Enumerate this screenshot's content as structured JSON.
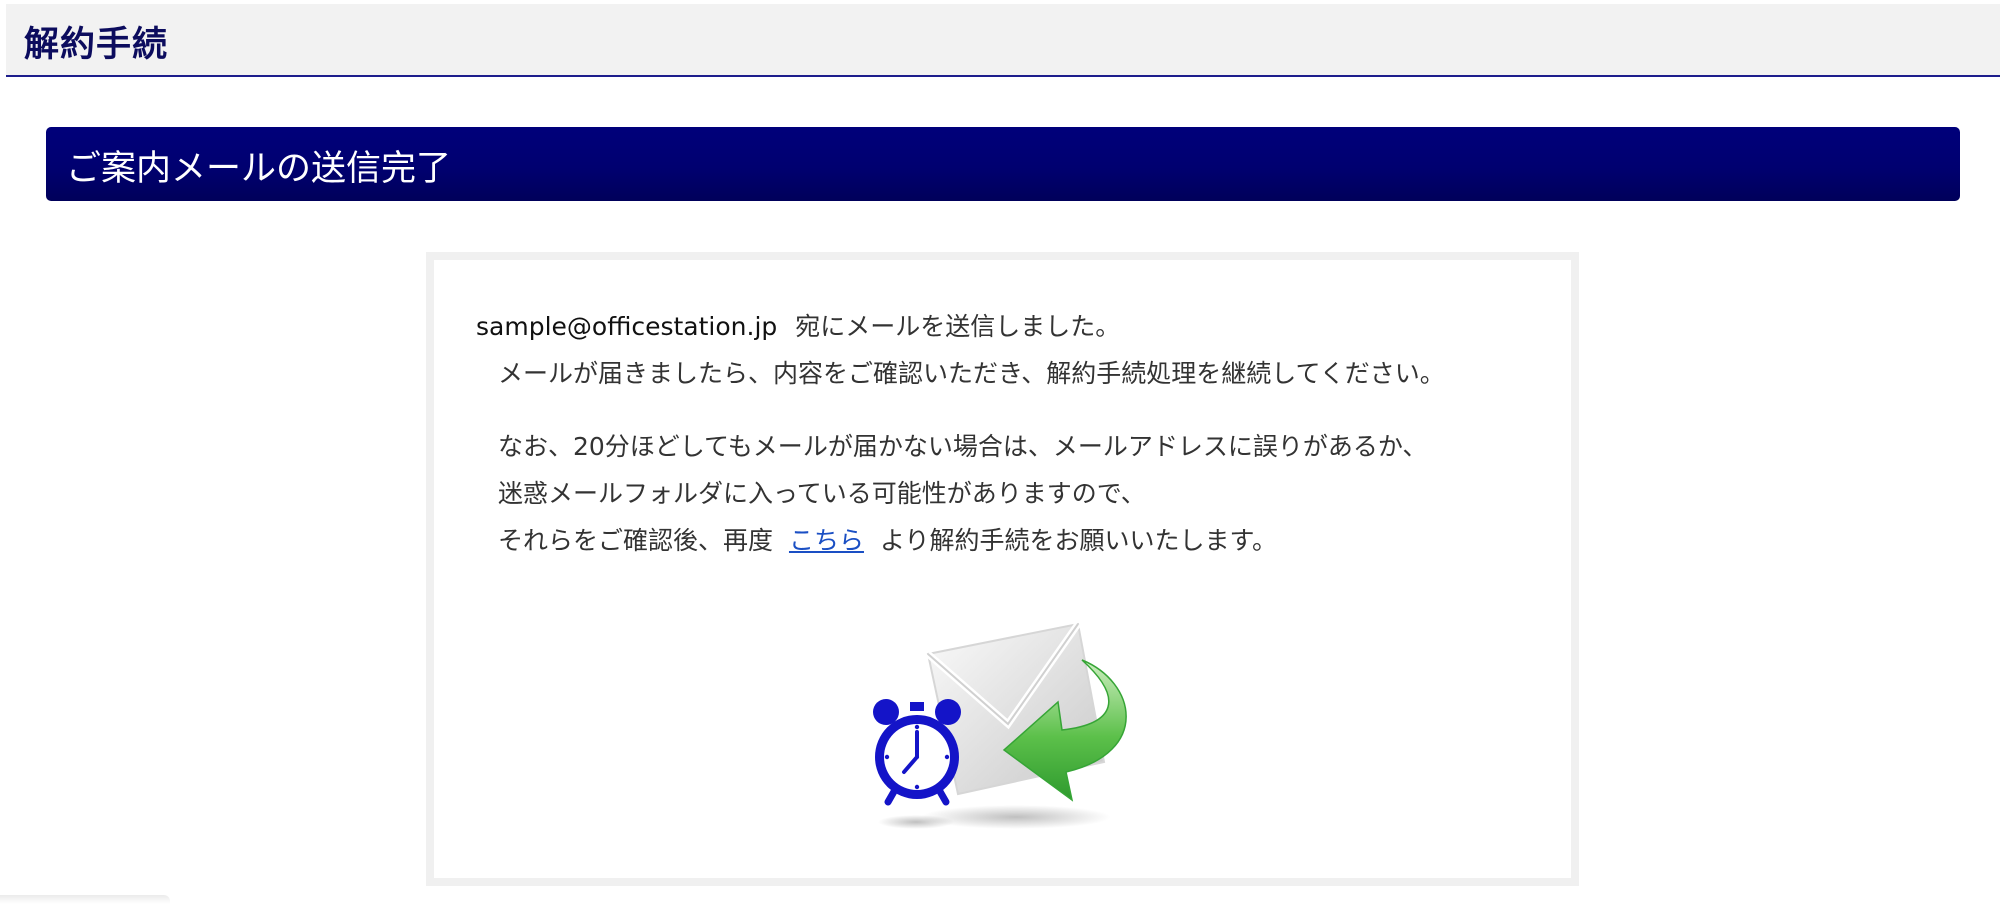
{
  "header": {
    "title": "解約手続"
  },
  "section": {
    "title": "ご案内メールの送信完了"
  },
  "message": {
    "email": "sample@officestation.jp",
    "line1_suffix": "宛にメールを送信しました。",
    "line2": "メールが届きましたら、内容をご確認いただき、解約手続処理を継続してください。",
    "line3": "なお、20分ほどしてもメールが届かない場合は、メールアドレスに誤りがあるか、",
    "line4": "迷惑メールフォルダに入っている可能性がありますので、",
    "line5_prefix": "それらをご確認後、再度",
    "link_label": "こちら",
    "line5_suffix": "より解約手続をお願いいたします。"
  },
  "illustration": {
    "icons": [
      "alarm-clock-icon",
      "envelope-icon",
      "return-arrow-icon"
    ]
  },
  "colors": {
    "header_bg": "#f2f2f2",
    "header_rule": "#1d1d8c",
    "title_text": "#0c0c5e",
    "banner_bg": "#00006e",
    "link": "#1a4fc4",
    "clock_blue": "#1414c8",
    "arrow_green": "#3db33d"
  }
}
